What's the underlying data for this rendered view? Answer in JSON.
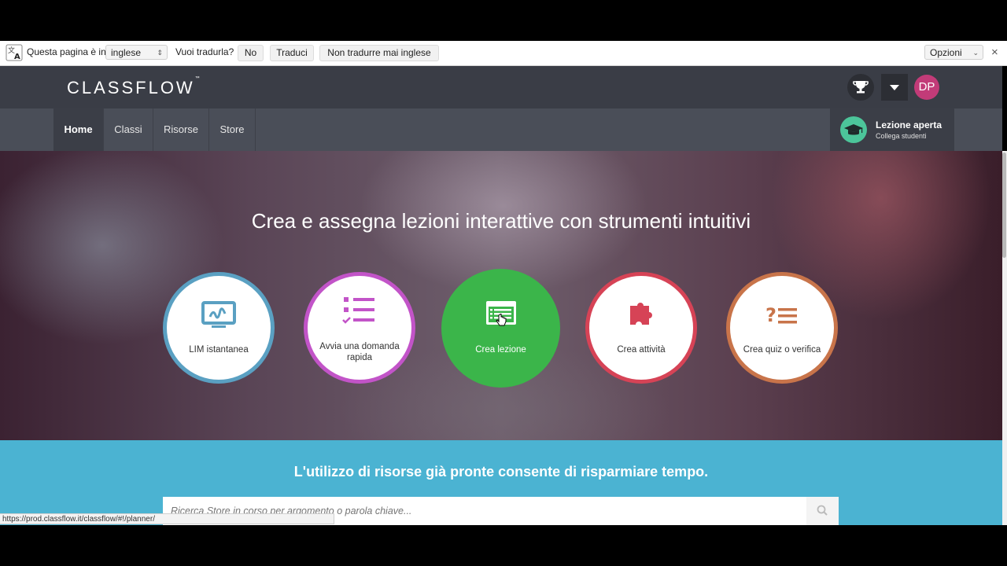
{
  "translate_bar": {
    "prompt": "Questa pagina è in",
    "language": "inglese",
    "question": "Vuoi tradurla?",
    "btn_no": "No",
    "btn_translate": "Traduci",
    "btn_never": "Non tradurre mai inglese",
    "options": "Opzioni",
    "close": "×"
  },
  "header": {
    "logo": "CLASSFLOW",
    "logo_tm": "™",
    "avatar_initials": "DP",
    "avatar_color": "#c23b78"
  },
  "nav": {
    "items": [
      {
        "label": "Home",
        "active": true
      },
      {
        "label": "Classi",
        "active": false
      },
      {
        "label": "Risorse",
        "active": false
      },
      {
        "label": "Store",
        "active": false
      }
    ],
    "lesson": {
      "title": "Lezione aperta",
      "subtitle": "Collega studenti",
      "icon_bg": "#4cc59a"
    }
  },
  "hero": {
    "title": "Crea e assegna lezioni interattive con strumenti intuitivi",
    "actions": [
      {
        "label": "LIM istantanea",
        "color": "#5aa0c2",
        "icon": "whiteboard-icon"
      },
      {
        "label": "Avvia una domanda rapida",
        "color": "#c254c8",
        "icon": "checklist-icon"
      },
      {
        "label": "Crea lezione",
        "color": "#3bb54a",
        "icon": "lesson-icon"
      },
      {
        "label": "Crea attività",
        "color": "#d64356",
        "icon": "puzzle-icon"
      },
      {
        "label": "Crea quiz o verifica",
        "color": "#c8744a",
        "icon": "quiz-icon"
      }
    ]
  },
  "resources": {
    "title": "L'utilizzo di risorse già pronte consente di risparmiare tempo.",
    "search_placeholder": "Ricerca Store in corso per argomento o parola chiave..."
  },
  "status": {
    "url": "https://prod.classflow.it/classflow/#!/planner/"
  }
}
